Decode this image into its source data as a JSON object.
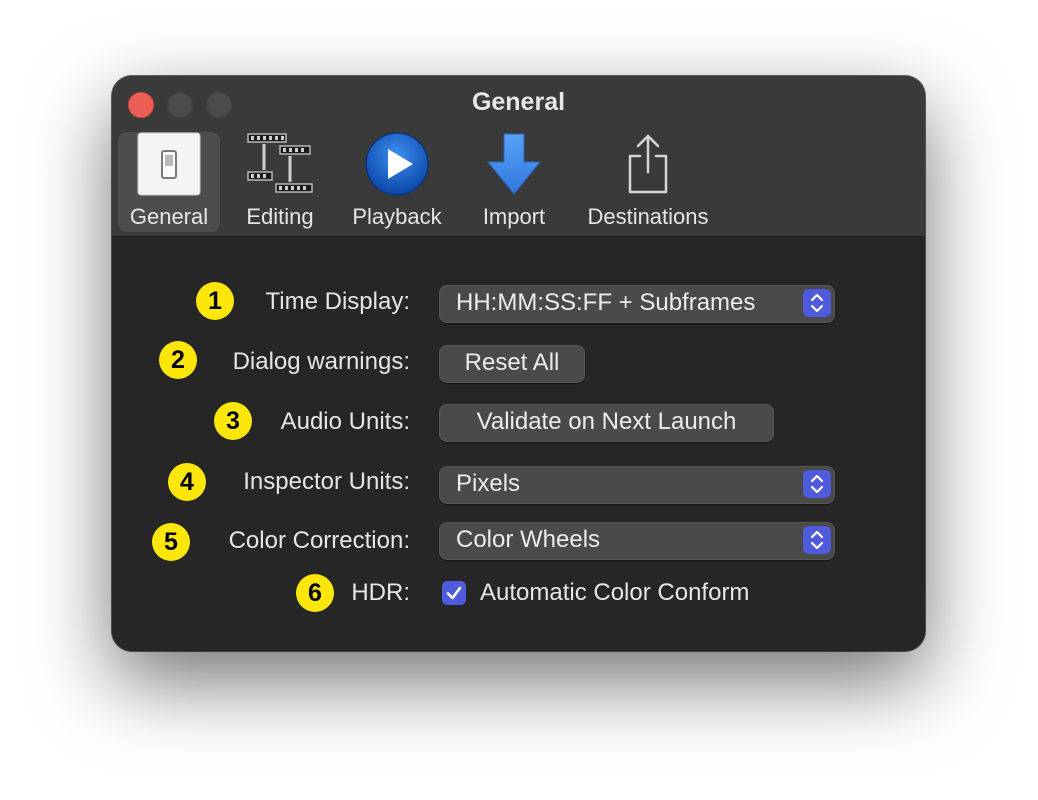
{
  "window": {
    "title": "General"
  },
  "toolbar": {
    "tabs": [
      {
        "label": "General",
        "icon": "switch-icon",
        "selected": true
      },
      {
        "label": "Editing",
        "icon": "film-editing-icon",
        "selected": false
      },
      {
        "label": "Playback",
        "icon": "play-icon",
        "selected": false
      },
      {
        "label": "Import",
        "icon": "download-arrow-icon",
        "selected": false
      },
      {
        "label": "Destinations",
        "icon": "share-icon",
        "selected": false
      }
    ]
  },
  "settings": {
    "time_display": {
      "badge": "1",
      "label": "Time Display:",
      "value": "HH:MM:SS:FF + Subframes"
    },
    "dialog_warnings": {
      "badge": "2",
      "label": "Dialog warnings:",
      "button": "Reset All"
    },
    "audio_units": {
      "badge": "3",
      "label": "Audio Units:",
      "button": "Validate on Next Launch"
    },
    "inspector_units": {
      "badge": "4",
      "label": "Inspector Units:",
      "value": "Pixels"
    },
    "color_correction": {
      "badge": "5",
      "label": "Color Correction:",
      "value": "Color Wheels"
    },
    "hdr": {
      "badge": "6",
      "label": "HDR:",
      "checkbox_label": "Automatic Color Conform",
      "checked": true
    }
  },
  "colors": {
    "accent": "#4e5bdc",
    "badge": "#fde70a",
    "window_bg": "#262626",
    "toolbar_bg": "#3a3a3a",
    "close_button": "#ed5f56"
  }
}
